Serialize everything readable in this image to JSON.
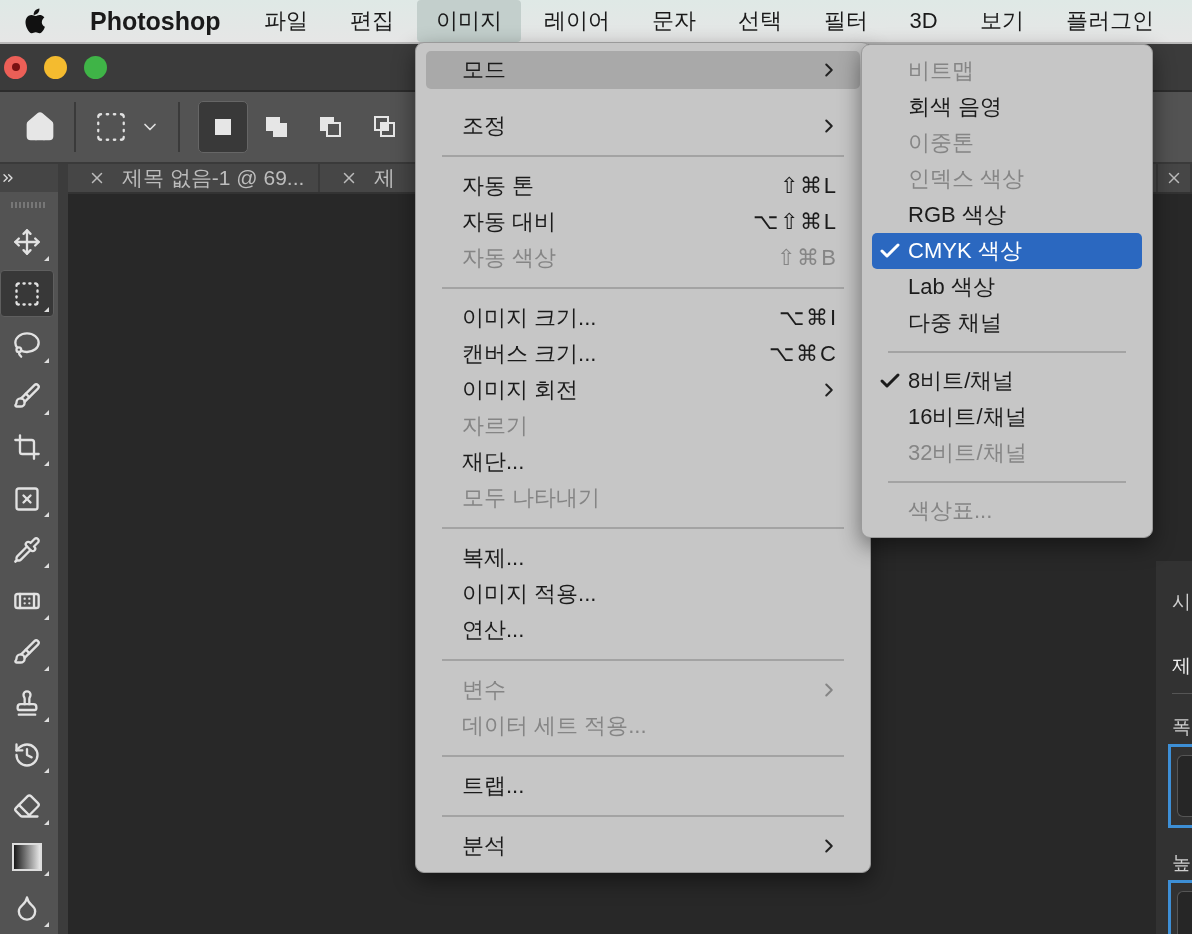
{
  "menubar": {
    "app": "Photoshop",
    "items": [
      {
        "label": "파일",
        "selected": false
      },
      {
        "label": "편집",
        "selected": false
      },
      {
        "label": "이미지",
        "selected": true
      },
      {
        "label": "레이어",
        "selected": false
      },
      {
        "label": "문자",
        "selected": false
      },
      {
        "label": "선택",
        "selected": false
      },
      {
        "label": "필터",
        "selected": false
      },
      {
        "label": "3D",
        "selected": false
      },
      {
        "label": "보기",
        "selected": false
      },
      {
        "label": "플러그인",
        "selected": false
      }
    ]
  },
  "options_bar": {
    "modes": [
      {
        "kind": "new",
        "selected": true
      },
      {
        "kind": "add",
        "selected": false
      },
      {
        "kind": "subtract",
        "selected": false
      },
      {
        "kind": "intersect",
        "selected": false
      }
    ]
  },
  "tabs": [
    {
      "kind": "document",
      "label": "제목 없음-1 @ 69..."
    },
    {
      "kind": "document",
      "label": "제"
    },
    {
      "kind": "clipped"
    }
  ],
  "tools": [
    {
      "kind": "move",
      "selected": false
    },
    {
      "kind": "marquee",
      "selected": true
    },
    {
      "kind": "lasso",
      "selected": false
    },
    {
      "kind": "quick",
      "selected": false
    },
    {
      "kind": "crop",
      "selected": false
    },
    {
      "kind": "frame",
      "selected": false
    },
    {
      "kind": "eyedropper",
      "selected": false
    },
    {
      "kind": "heal",
      "selected": false
    },
    {
      "kind": "brush",
      "selected": false
    },
    {
      "kind": "stamp",
      "selected": false
    },
    {
      "kind": "history",
      "selected": false
    },
    {
      "kind": "eraser",
      "selected": false
    },
    {
      "kind": "gradient",
      "selected": false
    },
    {
      "kind": "blur",
      "selected": false
    }
  ],
  "image_menu": [
    {
      "kind": "item",
      "label": "모드",
      "highlighted": true,
      "disabled": false,
      "submenu": true
    },
    {
      "kind": "item",
      "label": "조정",
      "highlighted": false,
      "disabled": false,
      "submenu": true
    },
    {
      "kind": "separator"
    },
    {
      "kind": "item",
      "label": "자동 톤",
      "shortcut": "⇧⌘L",
      "highlighted": false,
      "disabled": false,
      "submenu": false
    },
    {
      "kind": "item",
      "label": "자동 대비",
      "shortcut": "⌥⇧⌘L",
      "highlighted": false,
      "disabled": false,
      "submenu": false
    },
    {
      "kind": "item",
      "label": "자동 색상",
      "shortcut": "⇧⌘B",
      "highlighted": false,
      "disabled": true,
      "submenu": false
    },
    {
      "kind": "separator"
    },
    {
      "kind": "item",
      "label": "이미지 크기...",
      "shortcut": "⌥⌘I",
      "highlighted": false,
      "disabled": false,
      "submenu": false
    },
    {
      "kind": "item",
      "label": "캔버스 크기...",
      "shortcut": "⌥⌘C",
      "highlighted": false,
      "disabled": false,
      "submenu": false
    },
    {
      "kind": "item",
      "label": "이미지 회전",
      "highlighted": false,
      "disabled": false,
      "submenu": true
    },
    {
      "kind": "item",
      "label": "자르기",
      "highlighted": false,
      "disabled": true,
      "submenu": false
    },
    {
      "kind": "item",
      "label": "재단...",
      "highlighted": false,
      "disabled": false,
      "submenu": false
    },
    {
      "kind": "item",
      "label": "모두 나타내기",
      "highlighted": false,
      "disabled": true,
      "submenu": false
    },
    {
      "kind": "separator"
    },
    {
      "kind": "item",
      "label": "복제...",
      "highlighted": false,
      "disabled": false,
      "submenu": false
    },
    {
      "kind": "item",
      "label": "이미지 적용...",
      "highlighted": false,
      "disabled": false,
      "submenu": false
    },
    {
      "kind": "item",
      "label": "연산...",
      "highlighted": false,
      "disabled": false,
      "submenu": false
    },
    {
      "kind": "separator"
    },
    {
      "kind": "item",
      "label": "변수",
      "highlighted": false,
      "disabled": true,
      "submenu": true
    },
    {
      "kind": "item",
      "label": "데이터 세트 적용...",
      "highlighted": false,
      "disabled": true,
      "submenu": false
    },
    {
      "kind": "separator"
    },
    {
      "kind": "item",
      "label": "트랩...",
      "highlighted": false,
      "disabled": false,
      "submenu": false
    },
    {
      "kind": "separator"
    },
    {
      "kind": "item",
      "label": "분석",
      "highlighted": false,
      "disabled": false,
      "submenu": true
    }
  ],
  "mode_submenu": [
    {
      "kind": "item",
      "label": "비트맵",
      "disabled": true,
      "checked": false,
      "selected": false
    },
    {
      "kind": "item",
      "label": "회색 음영",
      "disabled": false,
      "checked": false,
      "selected": false
    },
    {
      "kind": "item",
      "label": "이중톤",
      "disabled": true,
      "checked": false,
      "selected": false
    },
    {
      "kind": "item",
      "label": "인덱스 색상",
      "disabled": true,
      "checked": false,
      "selected": false
    },
    {
      "kind": "item",
      "label": "RGB 색상",
      "disabled": false,
      "checked": false,
      "selected": false
    },
    {
      "kind": "item",
      "label": "CMYK 색상",
      "disabled": false,
      "checked": true,
      "selected": true
    },
    {
      "kind": "item",
      "label": "Lab 색상",
      "disabled": false,
      "checked": false,
      "selected": false
    },
    {
      "kind": "item",
      "label": "다중 채널",
      "disabled": false,
      "checked": false,
      "selected": false
    },
    {
      "kind": "separator"
    },
    {
      "kind": "item",
      "label": "8비트/채널",
      "disabled": false,
      "checked": true,
      "selected": false
    },
    {
      "kind": "item",
      "label": "16비트/채널",
      "disabled": false,
      "checked": false,
      "selected": false
    },
    {
      "kind": "item",
      "label": "32비트/채널",
      "disabled": true,
      "checked": false,
      "selected": false
    },
    {
      "kind": "separator"
    },
    {
      "kind": "item",
      "label": "색상표...",
      "disabled": true,
      "checked": false,
      "selected": false
    }
  ],
  "side_panel": {
    "title": "시",
    "tab": "제",
    "fields": [
      {
        "label": "폭"
      },
      {
        "label": "높"
      }
    ]
  }
}
